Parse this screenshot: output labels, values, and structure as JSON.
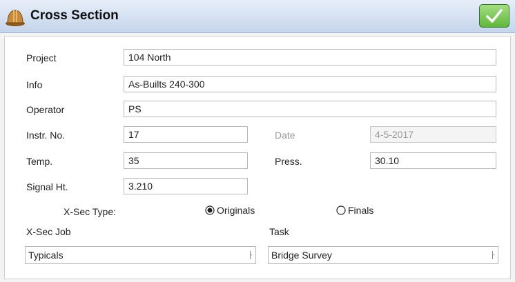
{
  "window": {
    "title": "Cross Section",
    "ok_icon": "check-icon",
    "app_icon": "hardhat-icon"
  },
  "form": {
    "project": {
      "label": "Project",
      "value": "104 North"
    },
    "info": {
      "label": "Info",
      "value": "As-Builts 240-300"
    },
    "operator": {
      "label": "Operator",
      "value": "PS"
    },
    "instr_no": {
      "label": "Instr. No.",
      "value": "17"
    },
    "date": {
      "label": "Date",
      "value": "4-5-2017"
    },
    "temp": {
      "label": "Temp.",
      "value": "35"
    },
    "press": {
      "label": "Press.",
      "value": "30.10"
    },
    "signal_ht": {
      "label": "Signal Ht.",
      "value": "3.210"
    },
    "xsec_type": {
      "label": "X-Sec Type:",
      "options": [
        "Originals",
        "Finals"
      ],
      "selected": "Originals"
    },
    "xsec_job": {
      "label": "X-Sec Job",
      "value": "Typicals"
    },
    "task": {
      "label": "Task",
      "value": "Bridge Survey"
    }
  }
}
